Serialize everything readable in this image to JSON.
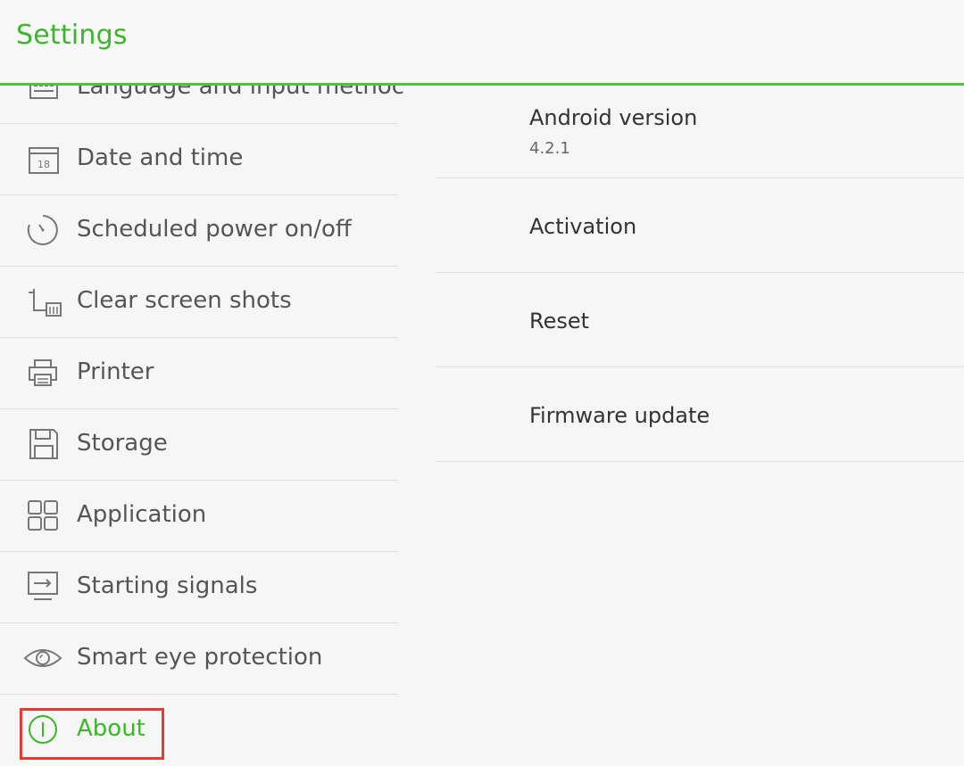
{
  "app": {
    "title": "Settings",
    "accent_color": "#3bb52a",
    "highlight_color": "#e53935"
  },
  "sidebar": {
    "items": [
      {
        "label": "Language and input methoc",
        "icon": "keyboard-icon",
        "active": false
      },
      {
        "label": "Date and time",
        "icon": "calendar-icon",
        "active": false
      },
      {
        "label": "Scheduled power on/off",
        "icon": "timer-icon",
        "active": false
      },
      {
        "label": "Clear screen shots",
        "icon": "crop-trash-icon",
        "active": false
      },
      {
        "label": "Printer",
        "icon": "printer-icon",
        "active": false
      },
      {
        "label": "Storage",
        "icon": "storage-icon",
        "active": false
      },
      {
        "label": "Application",
        "icon": "apps-grid-icon",
        "active": false
      },
      {
        "label": "Starting signals",
        "icon": "input-signal-icon",
        "active": false
      },
      {
        "label": "Smart eye protection",
        "icon": "eye-icon",
        "active": false
      },
      {
        "label": "About",
        "icon": "info-icon",
        "active": true
      }
    ]
  },
  "detail": {
    "items": [
      {
        "title": "Android version",
        "value": "4.2.1"
      },
      {
        "title": "Activation"
      },
      {
        "title": "Reset"
      },
      {
        "title": "Firmware update"
      }
    ]
  }
}
